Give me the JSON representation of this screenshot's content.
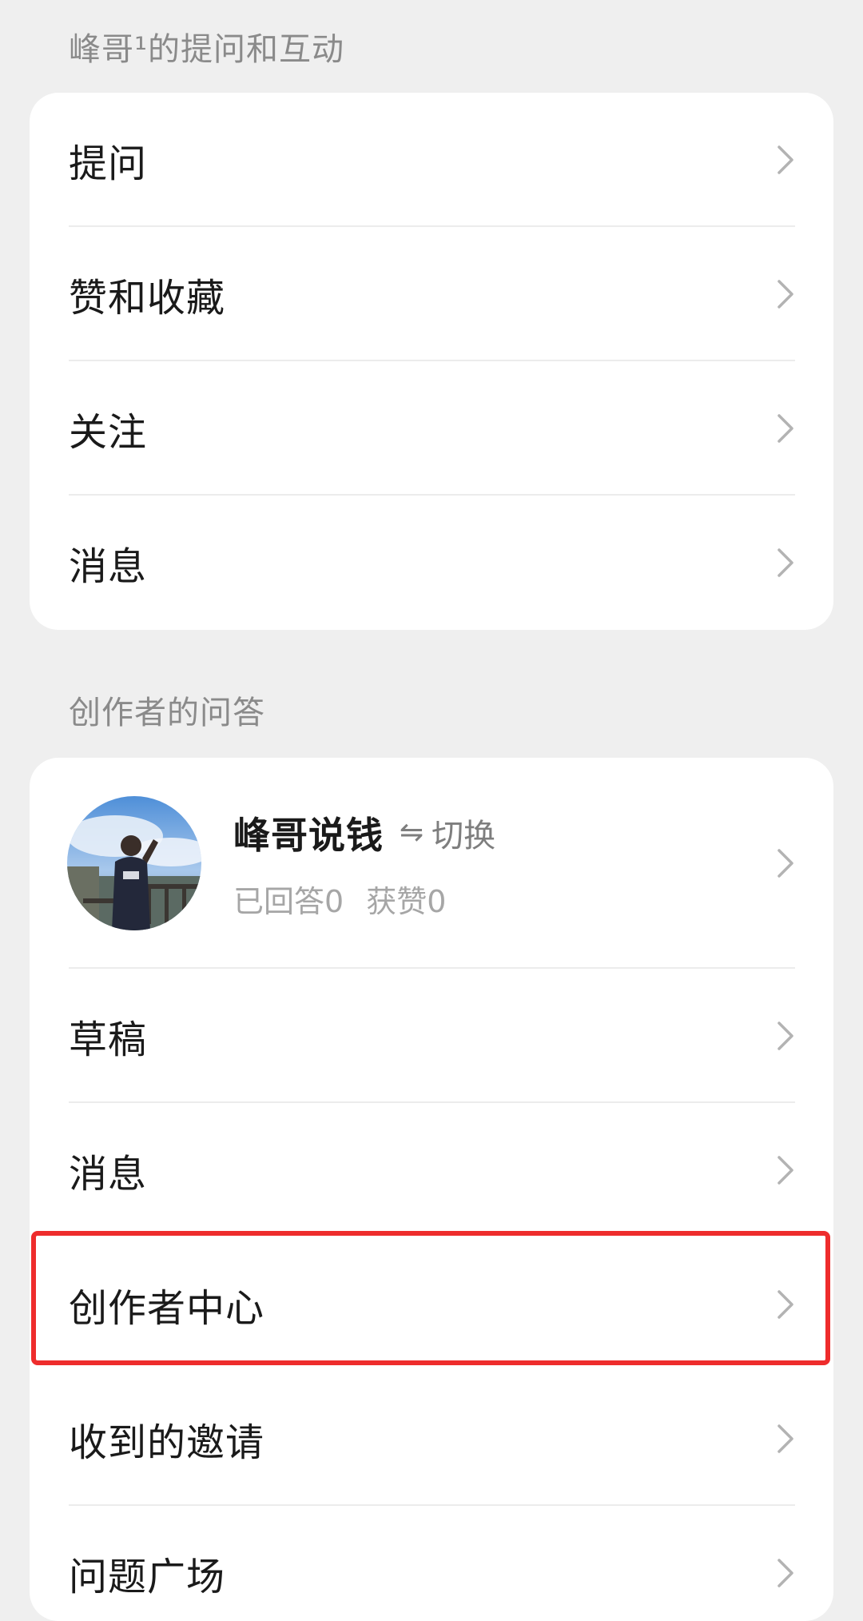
{
  "section1": {
    "title": "峰哥¹的提问和互动",
    "items": [
      {
        "label": "提问"
      },
      {
        "label": "赞和收藏"
      },
      {
        "label": "关注"
      },
      {
        "label": "消息"
      }
    ]
  },
  "section2": {
    "title": "创作者的问答",
    "profile": {
      "name": "峰哥说钱",
      "switch_label": "切换",
      "switch_icon": "⇋",
      "answered": "已回答0",
      "likes": "获赞0"
    },
    "items": [
      {
        "label": "草稿"
      },
      {
        "label": "消息"
      },
      {
        "label": "创作者中心"
      },
      {
        "label": "收到的邀请"
      },
      {
        "label": "问题广场"
      }
    ]
  },
  "colors": {
    "background": "#efefef",
    "card": "#ffffff",
    "highlight_border": "#ee2c2c"
  }
}
